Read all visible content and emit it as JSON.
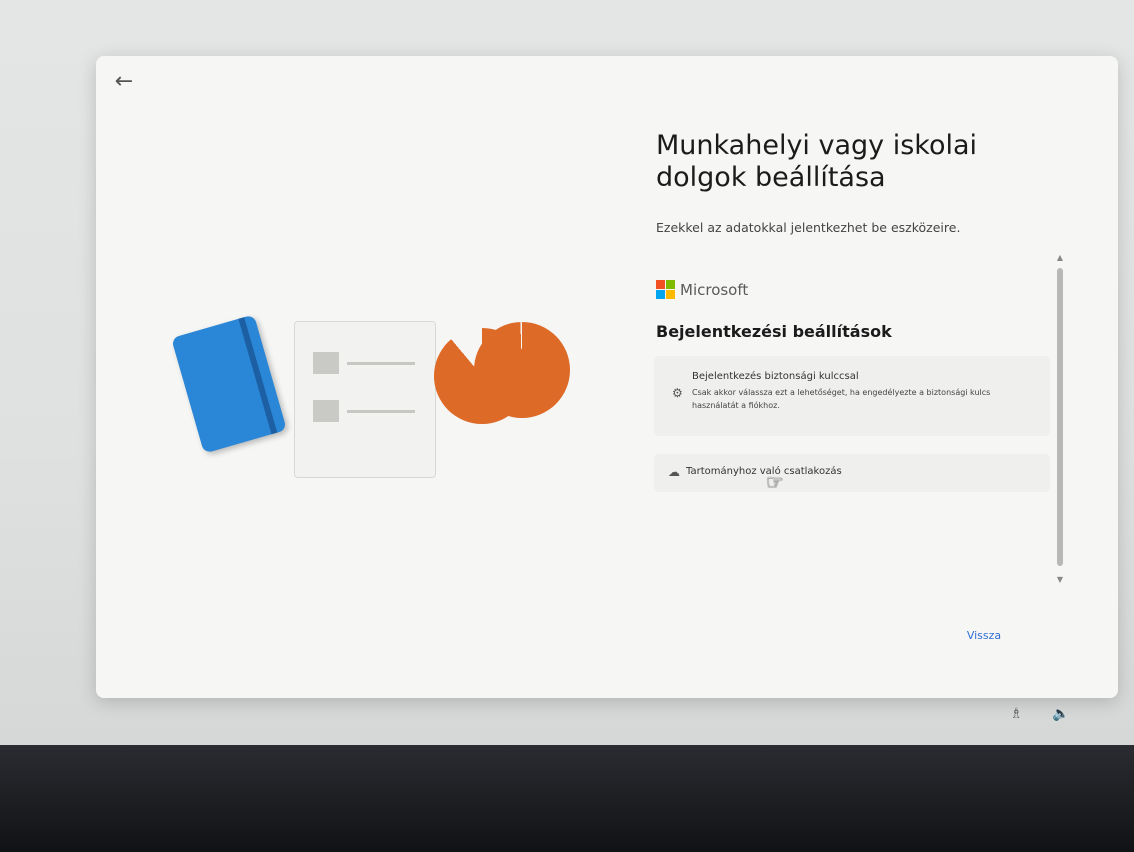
{
  "dialog": {
    "title": "Munkahelyi vagy iskolai dolgok beállítása",
    "subtitle": "Ezekkel az adatokkal jelentkezhet be eszközeire.",
    "brand": "Microsoft",
    "options_heading": "Bejelentkezési beállítások",
    "options": [
      {
        "icon": "key-icon",
        "title": "Bejelentkezés biztonsági kulccsal",
        "description": "Csak akkor válassza ezt a lehetőséget, ha engedélyezte a biztonsági kulcs használatát a fiókhoz."
      },
      {
        "icon": "domain-icon",
        "title": "Tartományhoz való csatlakozás"
      }
    ],
    "back_button": "Vissza"
  },
  "colors": {
    "accent": "#2f6fd4",
    "ms_red": "#f25022",
    "ms_green": "#7fba00",
    "ms_blue": "#00a4ef",
    "ms_yellow": "#ffb900",
    "notebook_blue": "#2a86d6",
    "pie_orange": "#dd6a27"
  },
  "icons": {
    "back": "back-arrow-icon",
    "tray": [
      "accessibility-icon",
      "volume-icon"
    ]
  }
}
